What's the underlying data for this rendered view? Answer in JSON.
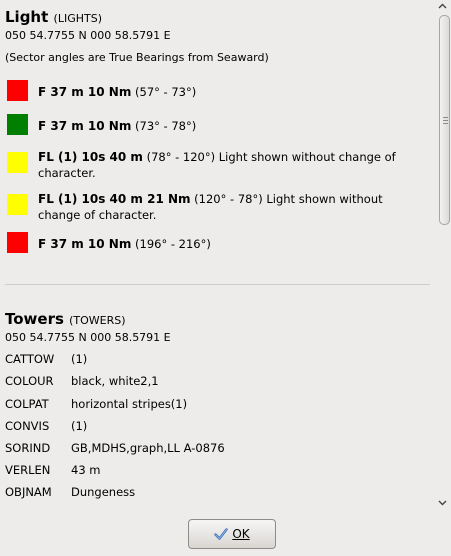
{
  "light": {
    "title": "Light",
    "code": "(LIGHTS)",
    "position": "050 54.7755 N 000 58.5791 E",
    "note": "(Sector angles are True Bearings from Seaward)",
    "sectors": [
      {
        "color": "#ff0000",
        "bold": "F 37 m 10 Nm",
        "detail": " (57° - 73°)"
      },
      {
        "color": "#007f00",
        "bold": "F 37 m 10 Nm",
        "detail": " (73° - 78°)"
      },
      {
        "color": "#ffff00",
        "bold": "FL (1) 10s 40 m",
        "detail": " (78° - 120°) Light shown without change of character."
      },
      {
        "color": "#ffff00",
        "bold": "FL (1) 10s 40 m 21 Nm",
        "detail": " (120° - 78°) Light shown without change of character."
      },
      {
        "color": "#ff0000",
        "bold": "F 37 m 10 Nm",
        "detail": " (196° - 216°)"
      }
    ]
  },
  "towers": {
    "title": "Towers",
    "code": "(TOWERS)",
    "position": "050 54.7755 N 000 58.5791 E",
    "attributes": [
      {
        "key": "CATTOW",
        "value": "(1)"
      },
      {
        "key": "COLOUR",
        "value": "black, white2,1"
      },
      {
        "key": "COLPAT",
        "value": "horizontal stripes(1)"
      },
      {
        "key": "CONVIS",
        "value": "(1)"
      },
      {
        "key": "SORIND",
        "value": "GB,MDHS,graph,LL A-0876"
      },
      {
        "key": "VERLEN",
        "value": "43 m"
      },
      {
        "key": "OBJNAM",
        "value": "Dungeness"
      }
    ]
  },
  "ok_button": {
    "label": "OK",
    "icon": "checkmark-icon"
  },
  "scrollbar": {
    "up_icon": "arrow-up-icon",
    "down_icon": "arrow-down-icon"
  }
}
